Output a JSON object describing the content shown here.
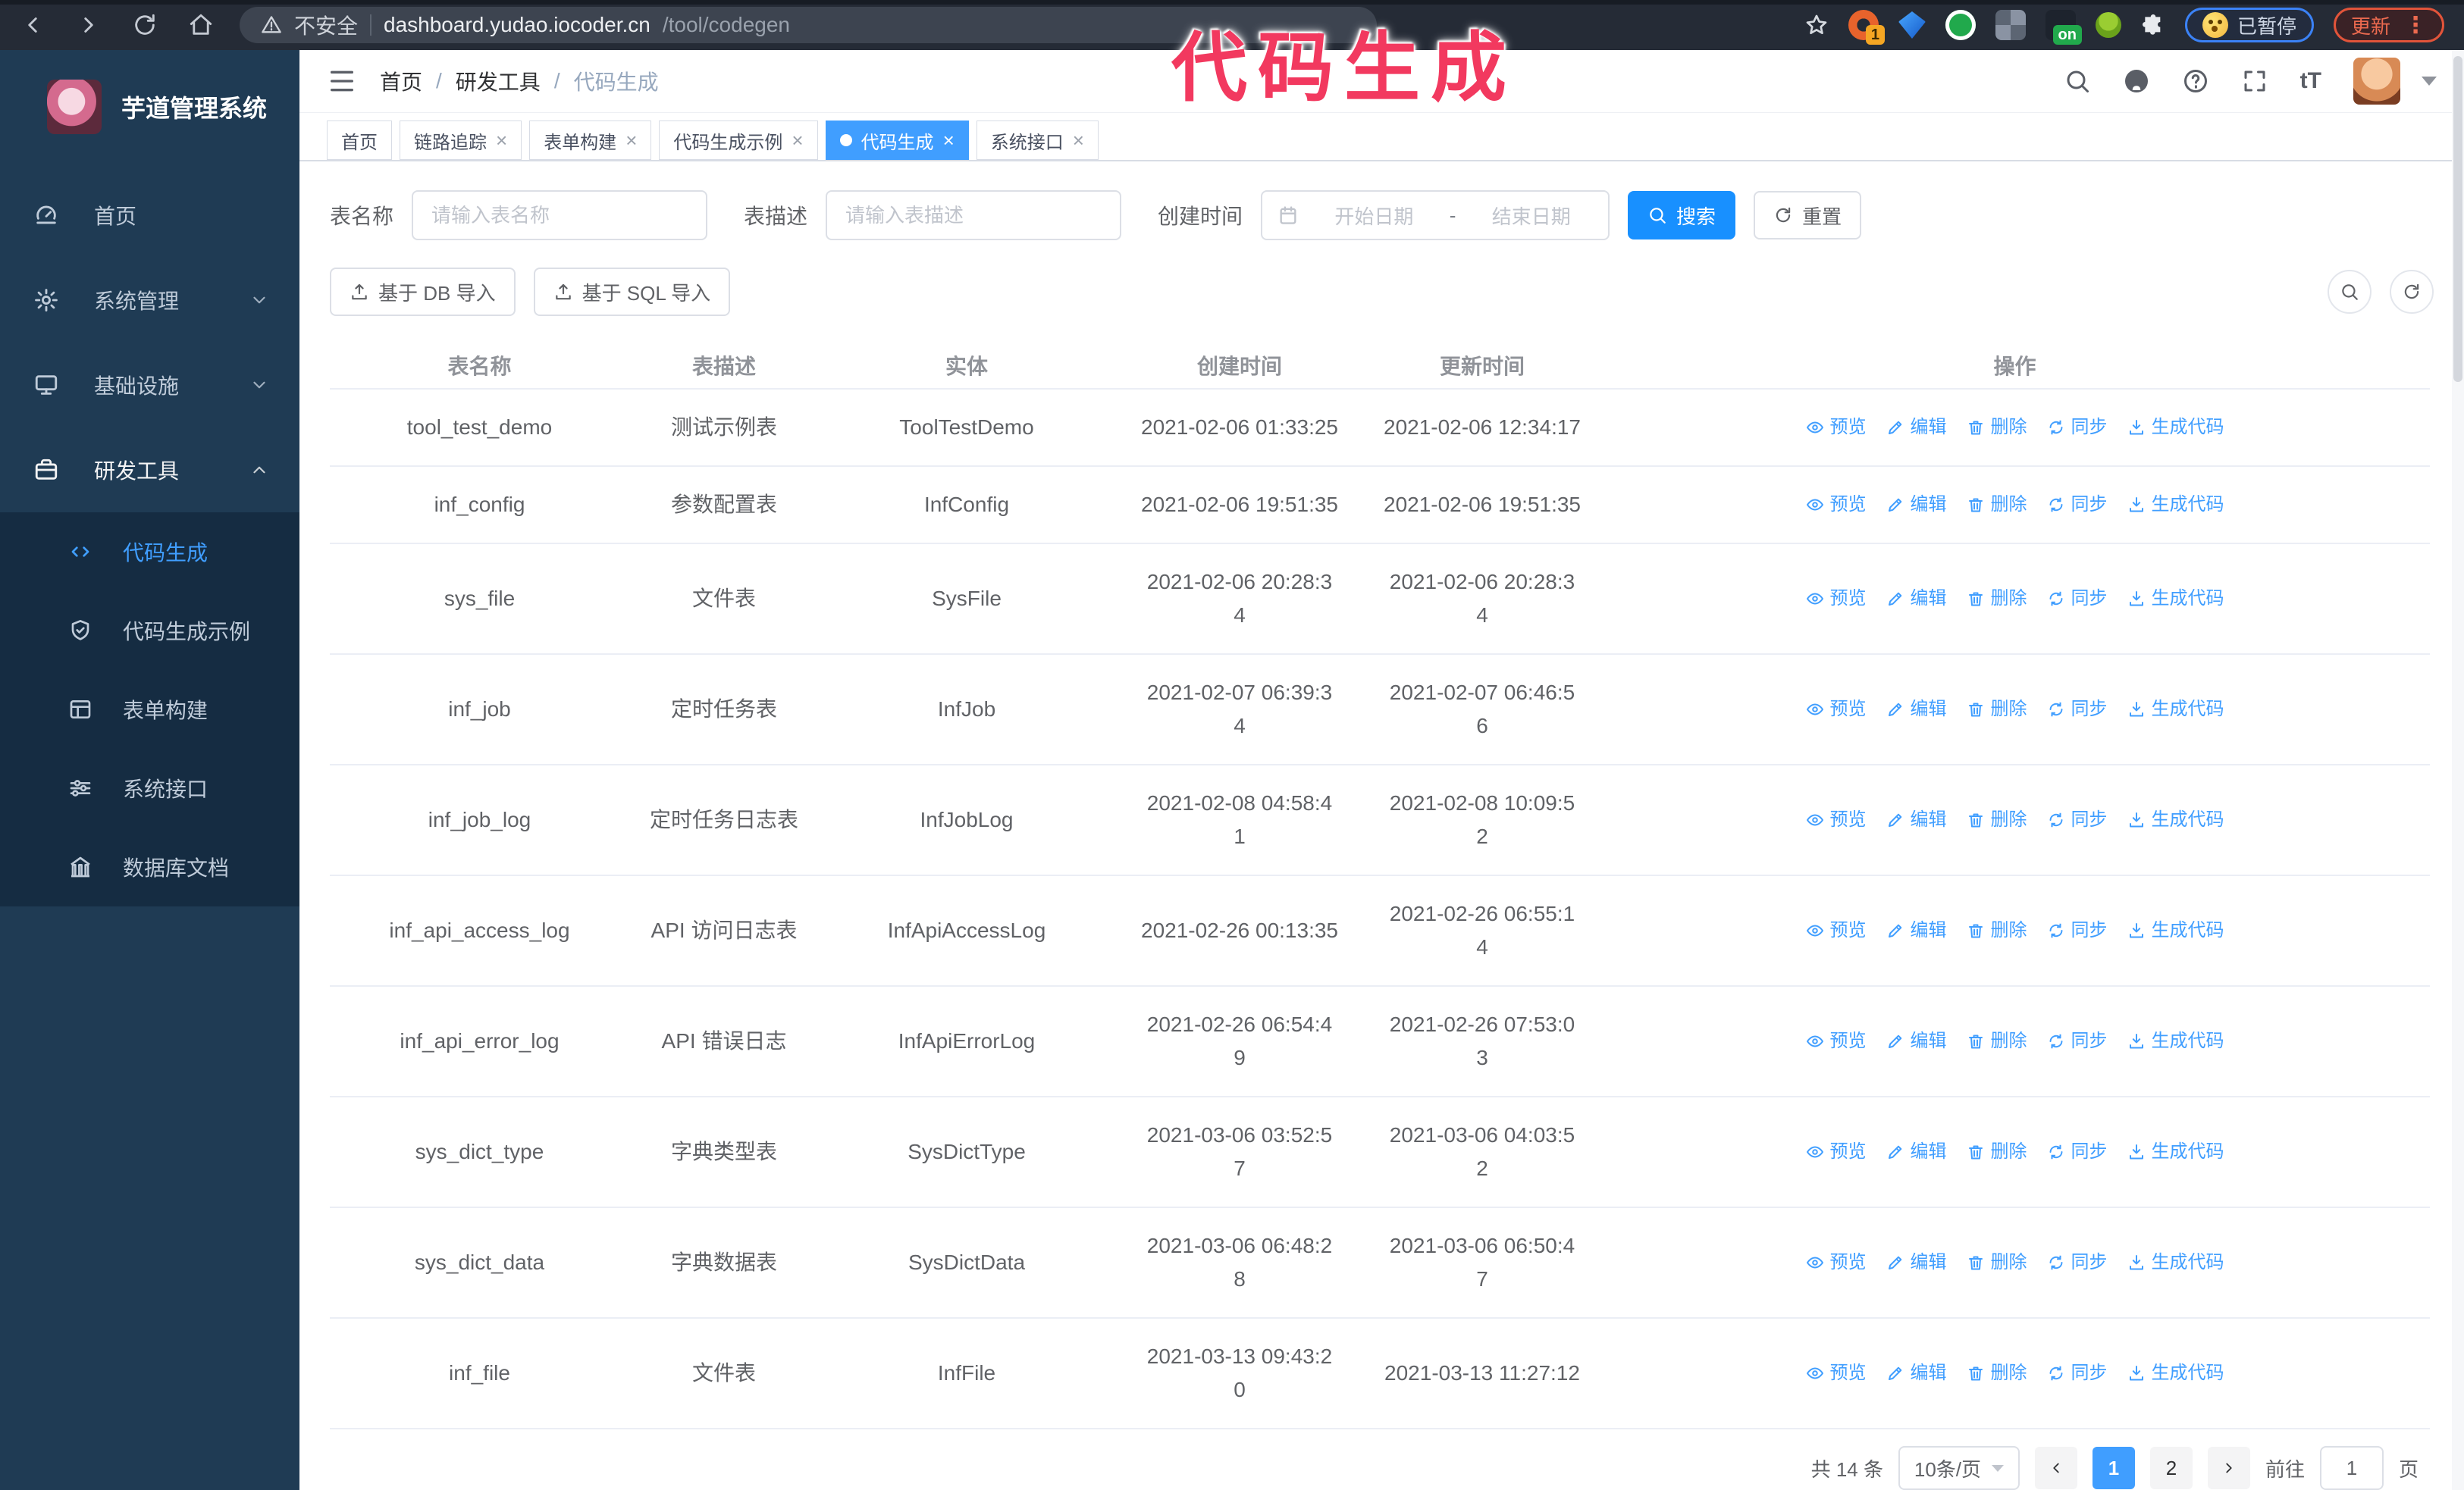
{
  "colors": {
    "primary": "#409eff",
    "search_button": "#1890ff",
    "sidebar_bg": "#1f3b54",
    "submenu_bg": "#152c42",
    "annotation_pink": "#f2395f",
    "active_tab": "#409eff"
  },
  "glyphs": {
    "close": "×",
    "dots": "⋮",
    "separator": "/",
    "tsize": "tT"
  },
  "browser": {
    "security_label": "不安全",
    "url_host": "dashboard.yudao.iocoder.cn",
    "url_path": "/tool/codegen",
    "ext_badge_count": "1",
    "ext_badge_on": "on",
    "paused_badge": "已暂停",
    "update_button": "更新"
  },
  "annotation": "代码生成",
  "sidebar": {
    "app_title": "芋道管理系统",
    "items": [
      {
        "label": "首页",
        "icon": "dashboard-icon"
      },
      {
        "label": "系统管理",
        "icon": "gear-icon"
      },
      {
        "label": "基础设施",
        "icon": "monitor-icon"
      },
      {
        "label": "研发工具",
        "icon": "toolbox-icon"
      }
    ],
    "submenu": [
      {
        "label": "代码生成",
        "icon": "code-icon"
      },
      {
        "label": "代码生成示例",
        "icon": "shield-check-icon"
      },
      {
        "label": "表单构建",
        "icon": "form-icon"
      },
      {
        "label": "系统接口",
        "icon": "sliders-icon"
      },
      {
        "label": "数据库文档",
        "icon": "database-icon"
      }
    ]
  },
  "header": {
    "breadcrumb": [
      "首页",
      "研发工具",
      "代码生成"
    ]
  },
  "tabs": [
    {
      "label": "首页"
    },
    {
      "label": "链路追踪"
    },
    {
      "label": "表单构建"
    },
    {
      "label": "代码生成示例"
    },
    {
      "label": "代码生成"
    },
    {
      "label": "系统接口"
    }
  ],
  "filters": {
    "name_label": "表名称",
    "name_placeholder": "请输入表名称",
    "desc_label": "表描述",
    "desc_placeholder": "请输入表描述",
    "time_label": "创建时间",
    "date_start_placeholder": "开始日期",
    "date_separator": "-",
    "date_end_placeholder": "结束日期",
    "search_label": "搜索",
    "reset_label": "重置"
  },
  "toolbar": {
    "import_db_label": "基于 DB 导入",
    "import_sql_label": "基于 SQL 导入"
  },
  "table": {
    "columns": [
      "表名称",
      "表描述",
      "实体",
      "创建时间",
      "更新时间",
      "操作"
    ],
    "actions": [
      "预览",
      "编辑",
      "删除",
      "同步",
      "生成代码"
    ],
    "rows": [
      {
        "name": "tool_test_demo",
        "desc": "测试示例表",
        "entity": "ToolTestDemo",
        "created": "2021-02-06 01:33:25",
        "updated": "2021-02-06 12:34:17"
      },
      {
        "name": "inf_config",
        "desc": "参数配置表",
        "entity": "InfConfig",
        "created": "2021-02-06 19:51:35",
        "updated": "2021-02-06 19:51:35"
      },
      {
        "name": "sys_file",
        "desc": "文件表",
        "entity": "SysFile",
        "created": "2021-02-06 20:28:3\n4",
        "updated": "2021-02-06 20:28:3\n4"
      },
      {
        "name": "inf_job",
        "desc": "定时任务表",
        "entity": "InfJob",
        "created": "2021-02-07 06:39:3\n4",
        "updated": "2021-02-07 06:46:5\n6"
      },
      {
        "name": "inf_job_log",
        "desc": "定时任务日志表",
        "entity": "InfJobLog",
        "created": "2021-02-08 04:58:4\n1",
        "updated": "2021-02-08 10:09:5\n2"
      },
      {
        "name": "inf_api_access_log",
        "desc": "API 访问日志表",
        "entity": "InfApiAccessLog",
        "created": "2021-02-26 00:13:35",
        "updated": "2021-02-26 06:55:1\n4"
      },
      {
        "name": "inf_api_error_log",
        "desc": "API 错误日志",
        "entity": "InfApiErrorLog",
        "created": "2021-02-26 06:54:4\n9",
        "updated": "2021-02-26 07:53:0\n3"
      },
      {
        "name": "sys_dict_type",
        "desc": "字典类型表",
        "entity": "SysDictType",
        "created": "2021-03-06 03:52:5\n7",
        "updated": "2021-03-06 04:03:5\n2"
      },
      {
        "name": "sys_dict_data",
        "desc": "字典数据表",
        "entity": "SysDictData",
        "created": "2021-03-06 06:48:2\n8",
        "updated": "2021-03-06 06:50:4\n7"
      },
      {
        "name": "inf_file",
        "desc": "文件表",
        "entity": "InfFile",
        "created": "2021-03-13 09:43:2\n0",
        "updated": "2021-03-13 11:27:12"
      }
    ]
  },
  "pagination": {
    "total_label": "共 14 条",
    "page_size_label": "10条/页",
    "pages": [
      "1",
      "2"
    ],
    "goto_label": "前往",
    "goto_value": "1",
    "goto_suffix": "页"
  }
}
